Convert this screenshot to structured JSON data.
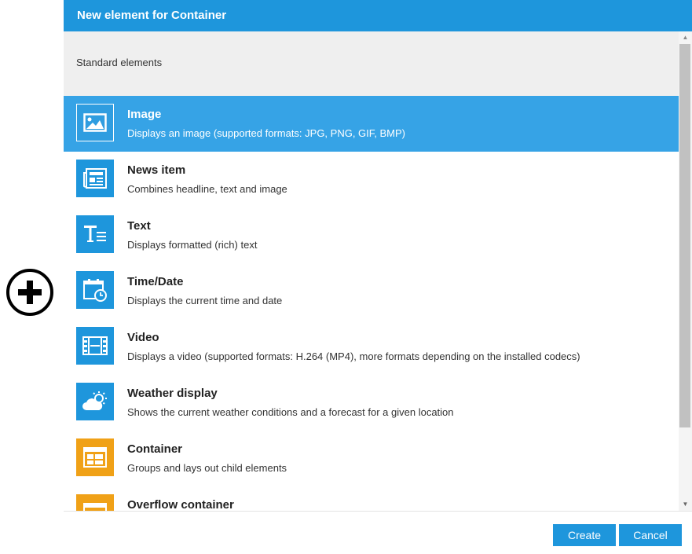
{
  "dialog": {
    "title": "New element for Container",
    "section_title": "Standard elements",
    "items": [
      {
        "title": "Image",
        "desc": "Displays an image (supported formats: JPG, PNG, GIF, BMP)",
        "icon": "image-icon",
        "color": "#1e96dc"
      },
      {
        "title": "News item",
        "desc": "Combines headline, text and image",
        "icon": "news-icon",
        "color": "#1e96dc"
      },
      {
        "title": "Text",
        "desc": "Displays formatted (rich) text",
        "icon": "text-icon",
        "color": "#1e96dc"
      },
      {
        "title": "Time/Date",
        "desc": "Displays the current time and date",
        "icon": "calendar-clock-icon",
        "color": "#1e96dc"
      },
      {
        "title": "Video",
        "desc": "Displays a video (supported formats: H.264 (MP4), more formats depending on the installed codecs)",
        "icon": "film-icon",
        "color": "#1e96dc"
      },
      {
        "title": "Weather display",
        "desc": "Shows the current weather conditions and a forecast for a given location",
        "icon": "weather-icon",
        "color": "#1e96dc"
      },
      {
        "title": "Container",
        "desc": "Groups and lays out child elements",
        "icon": "container-icon",
        "color": "#f0a117"
      },
      {
        "title": "Overflow container",
        "desc": "",
        "icon": "overflow-container-icon",
        "color": "#f0a117"
      }
    ],
    "selected_index": 0,
    "buttons": {
      "create": "Create",
      "cancel": "Cancel"
    }
  },
  "colors": {
    "accent": "#1e96dc",
    "selected": "#36a3e6",
    "container": "#f0a117"
  }
}
